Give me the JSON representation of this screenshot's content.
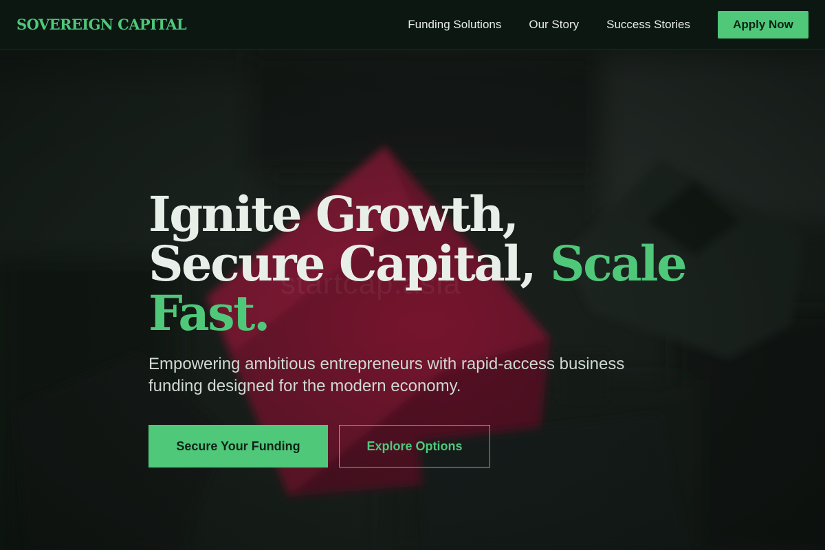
{
  "header": {
    "brand": "SOVEREIGN CAPITAL",
    "nav": [
      {
        "label": "Funding Solutions"
      },
      {
        "label": "Our Story"
      },
      {
        "label": "Success Stories"
      }
    ],
    "cta_label": "Apply Now"
  },
  "hero": {
    "title_part1": "Ignite Growth, Secure Capital, ",
    "title_accent": "Scale Fast.",
    "subtitle": "Empowering ambitious entrepreneurs with rapid-access business funding designed for the modern economy.",
    "primary_cta": "Secure Your Funding",
    "secondary_cta": "Explore Options",
    "watermark": "startcap.asia"
  },
  "colors": {
    "accent": "#4fc87a",
    "header_bg": "#0c1712",
    "text_light": "#e8efe9"
  }
}
